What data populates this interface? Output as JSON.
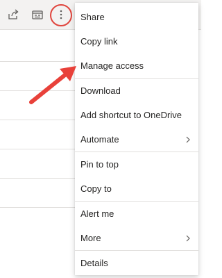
{
  "toolbar": {
    "share_icon": "share-icon",
    "workflow_icon": "workflow-icon",
    "more_icon": "more-vertical-icon"
  },
  "menu": {
    "groups": [
      [
        {
          "label": "Share"
        },
        {
          "label": "Copy link"
        },
        {
          "label": "Manage access"
        }
      ],
      [
        {
          "label": "Download"
        },
        {
          "label": "Add shortcut to OneDrive"
        },
        {
          "label": "Automate",
          "submenu": true
        }
      ],
      [
        {
          "label": "Pin to top"
        },
        {
          "label": "Copy to"
        }
      ],
      [
        {
          "label": "Alert me"
        },
        {
          "label": "More",
          "submenu": true
        }
      ],
      [
        {
          "label": "Details"
        }
      ]
    ]
  },
  "colors": {
    "highlight_ring": "#e0453d",
    "arrow": "#e8413a"
  }
}
